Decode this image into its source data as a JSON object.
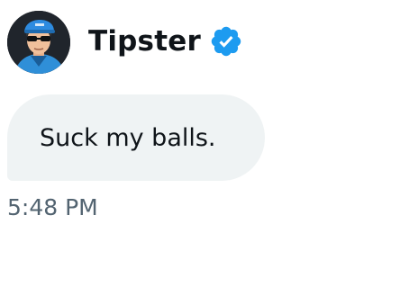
{
  "sender": {
    "display_name": "Tipster",
    "verified": true,
    "avatar_icon": "user-avatar-icon",
    "verified_icon": "verified-badge-icon",
    "verified_color": "#1d9bf0"
  },
  "message": {
    "text": "Suck my balls.",
    "timestamp": "5:48 PM",
    "bubble_color": "#eff3f4",
    "text_color": "#0f1419",
    "timestamp_color": "#536471"
  }
}
